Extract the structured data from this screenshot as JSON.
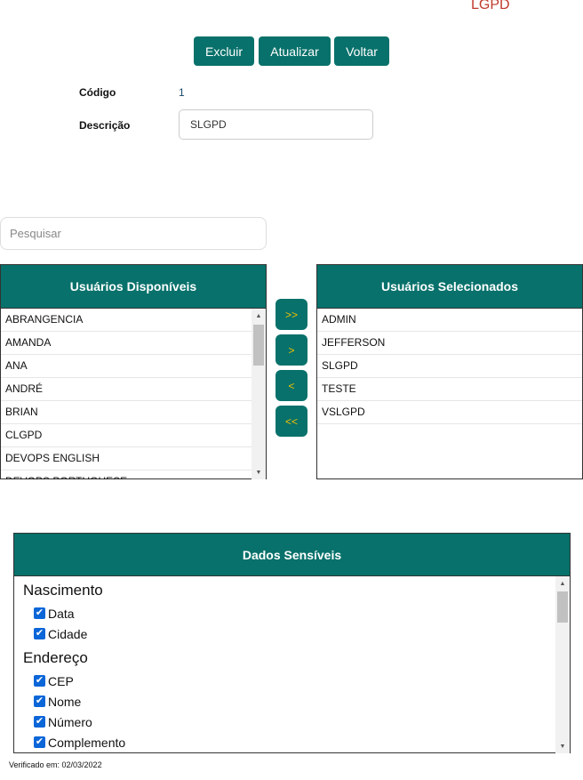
{
  "header": {
    "title": "LGPD"
  },
  "toolbar": {
    "delete_label": "Excluir",
    "update_label": "Atualizar",
    "back_label": "Voltar"
  },
  "form": {
    "code_label": "Código",
    "code_value": "1",
    "description_label": "Descrição",
    "description_value": "SLGPD"
  },
  "search": {
    "placeholder": "Pesquisar"
  },
  "available_users": {
    "title": "Usuários Disponíveis",
    "items": [
      "ABRANGENCIA",
      "AMANDA",
      "ANA",
      "ANDRÉ",
      "BRIAN",
      "CLGPD",
      "DEVOPS ENGLISH",
      "DEVOPS PORTUGUESE"
    ]
  },
  "transfer_buttons": {
    "all_right": ">>",
    "right": ">",
    "left": "<",
    "all_left": "<<"
  },
  "selected_users": {
    "title": "Usuários Selecionados",
    "items": [
      "ADMIN",
      "JEFFERSON",
      "SLGPD",
      "TESTE",
      "VSLGPD"
    ]
  },
  "sensitive_data": {
    "title": "Dados Sensíveis",
    "groups": [
      {
        "name": "Nascimento",
        "fields": [
          {
            "label": "Data",
            "checked": true
          },
          {
            "label": "Cidade",
            "checked": true
          }
        ]
      },
      {
        "name": "Endereço",
        "fields": [
          {
            "label": "CEP",
            "checked": true
          },
          {
            "label": "Nome",
            "checked": true
          },
          {
            "label": "Número",
            "checked": true
          },
          {
            "label": "Complemento",
            "checked": true
          }
        ]
      }
    ]
  },
  "footer": {
    "verified_text": "Verificado em: 02/03/2022"
  },
  "colors": {
    "primary": "#08716b",
    "arrow_text": "#f2c200",
    "title_red": "#c0392b",
    "checkbox": "#0b66d8"
  },
  "icons": {
    "scroll_up": "triangle-up",
    "scroll_down": "triangle-down",
    "check": "checkmark"
  }
}
